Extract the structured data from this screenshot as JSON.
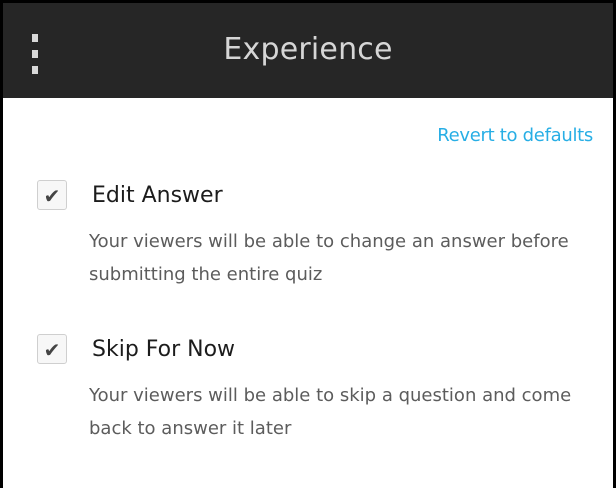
{
  "header": {
    "title": "Experience",
    "menu_icon": "kebab-menu-icon",
    "background_color": "#262626"
  },
  "revert_link": {
    "label": "Revert to defaults",
    "color": "#27aee5"
  },
  "options": [
    {
      "label": "Edit Answer",
      "checked": true,
      "description": "Your viewers will be able to change an answer before submitting the entire quiz"
    },
    {
      "label": "Skip For Now",
      "checked": true,
      "description": "Your viewers will be able to skip a question and come back to answer it later"
    }
  ],
  "check_glyph": "✔"
}
